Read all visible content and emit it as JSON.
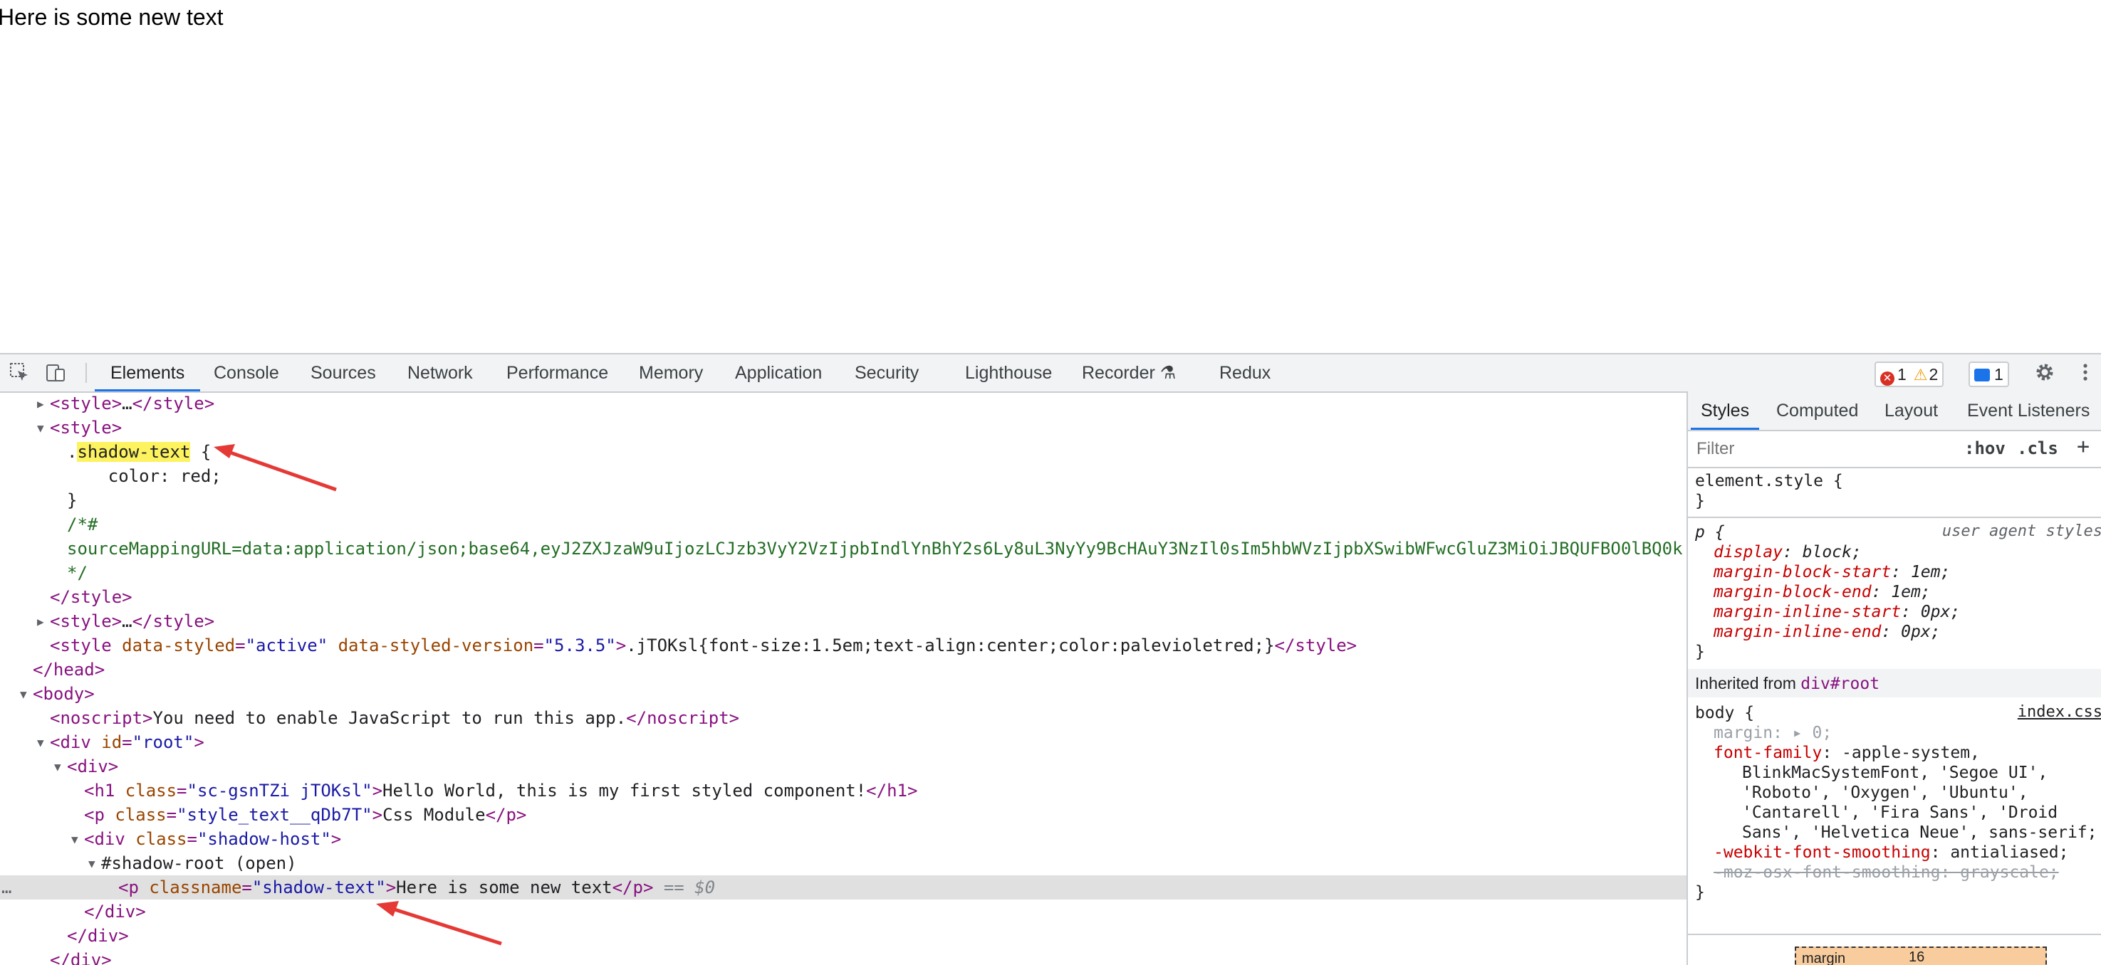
{
  "page": {
    "text": "Here is some new text"
  },
  "toolbar": {
    "tabs": [
      "Elements",
      "Console",
      "Sources",
      "Network",
      "Performance",
      "Memory",
      "Application",
      "Security",
      "Lighthouse",
      "Recorder",
      "Redux"
    ],
    "errors": "1",
    "warnings": "2",
    "messages": "1"
  },
  "elements": {
    "lines": {
      "l1": {
        "open": "<style>",
        "ellipsis": "…",
        "close": "</style>"
      },
      "l2": {
        "open": "<style>"
      },
      "l3": {
        "dot": ".",
        "sel": "shadow-text",
        "brace": " {"
      },
      "l4": {
        "text": "    color: red;"
      },
      "l5": {
        "text": "}"
      },
      "l6": {
        "text": "/*#"
      },
      "l7": {
        "text": "sourceMappingURL=data:application/json;base64,eyJ2ZXJzaW9uIjozLCJzb3VyY2VzIjpbIndlYnBhY2s6Ly8uL3NyYy9BcHAuY3NzIl0sIm5hbWVzIjpbXSwibWFwcGluZ3MiOiJBQUFBO0lBQ0k"
      },
      "l8": {
        "text": "*/"
      },
      "l9": {
        "close": "</style>"
      },
      "l10": {
        "open": "<style>",
        "ellipsis": "…",
        "close": "</style>"
      },
      "l11": {
        "tagopen": "<style ",
        "a1": "data-styled",
        "v1": "\"active\"",
        "a2": "data-styled-version",
        "v2": "\"5.3.5\"",
        "gt": ">",
        "content": ".jTOKsl{font-size:1.5em;text-align:center;color:palevioletred;}",
        "close": "</style>"
      },
      "l12": {
        "close": "</head>"
      },
      "l13": {
        "open": "<body>"
      },
      "l14": {
        "open": "<noscript>",
        "content": "You need to enable JavaScript to run this app.",
        "close": "</noscript>"
      },
      "l15": {
        "tagopen": "<div ",
        "a1": "id",
        "v1": "\"root\"",
        "gt": ">"
      },
      "l16": {
        "open": "<div>"
      },
      "l17": {
        "tagopen": "<h1 ",
        "a1": "class",
        "v1": "\"sc-gsnTZi jTOKsl\"",
        "gt": ">",
        "content": "Hello World, this is my first styled component!",
        "close": "</h1>"
      },
      "l18": {
        "tagopen": "<p ",
        "a1": "class",
        "v1": "\"style_text__qDb7T\"",
        "gt": ">",
        "content": "Css Module",
        "close": "</p>"
      },
      "l19": {
        "tagopen": "<div ",
        "a1": "class",
        "v1": "\"shadow-host\"",
        "gt": ">"
      },
      "l20": {
        "text": "#shadow-root (open)"
      },
      "l21": {
        "tagopen": "<p ",
        "a1": "classname",
        "v1": "\"shadow-text\"",
        "gt": ">",
        "content": "Here is some new text",
        "close": "</p>",
        "eq": " == $0",
        "dots": "…"
      },
      "l22": {
        "close": "</div>"
      },
      "l23": {
        "close": "</div>"
      },
      "l24": {
        "close": "</div>"
      }
    }
  },
  "styles": {
    "tabs": [
      "Styles",
      "Computed",
      "Layout",
      "Event Listeners"
    ],
    "filter_placeholder": "Filter",
    "hov": ":hov",
    "cls": ".cls",
    "plus": "+",
    "element_style": {
      "sel": "element.style {",
      "close": "}"
    },
    "p_rule": {
      "sel": "p {",
      "origin": "user agent styles",
      "props": [
        {
          "name": "display",
          "value": "block;"
        },
        {
          "name": "margin-block-start",
          "value": "1em;"
        },
        {
          "name": "margin-block-end",
          "value": "1em;"
        },
        {
          "name": "margin-inline-start",
          "value": "0px;"
        },
        {
          "name": "margin-inline-end",
          "value": "0px;"
        }
      ],
      "close": "}"
    },
    "inherited": {
      "label": "Inherited from ",
      "from": "div#root"
    },
    "body_rule": {
      "sel": "body {",
      "source": "index.css",
      "margin": "margin: ▸ 0;",
      "ff_name": "font-family",
      "ff_lines": [
        ": -apple-system,",
        "BlinkMacSystemFont, 'Segoe UI',",
        "'Roboto', 'Oxygen', 'Ubuntu',",
        "'Cantarell', 'Fira Sans', 'Droid",
        "Sans', 'Helvetica Neue', sans-serif;"
      ],
      "wfs_name": "-webkit-font-smoothing",
      "wfs_val": ": antialiased;",
      "moz": "-moz-osx-font-smoothing: grayscale;",
      "close": "}"
    },
    "box": {
      "label": "margin",
      "value": "16"
    }
  },
  "colors": {
    "accent": "#1a73e8",
    "arrow": "#e53935",
    "highlight": "#fdf35e"
  }
}
